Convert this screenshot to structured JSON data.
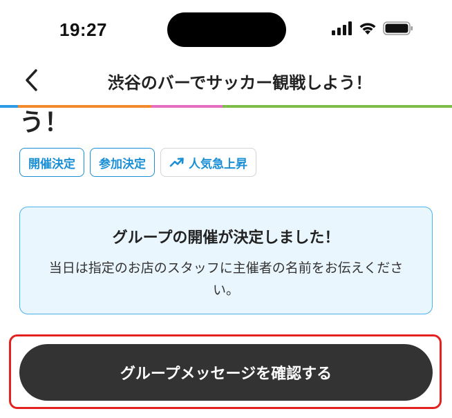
{
  "status_bar": {
    "time": "19:27"
  },
  "nav": {
    "title": "渋谷のバーでサッカー観戦しよう！"
  },
  "progress_colors": [
    "#2e9be6",
    "#f08a2c",
    "#e46fc0",
    "#7fbd4a"
  ],
  "content": {
    "title_tail": "う！",
    "tags": [
      {
        "label": "開催決定"
      },
      {
        "label": "参加決定"
      },
      {
        "label": "人気急上昇",
        "icon": "trending-up-icon"
      }
    ],
    "notice": {
      "title": "グループの開催が決定しました！",
      "body": "当日は指定のお店のスタッフに主催者の名前をお伝えください。"
    },
    "cta": {
      "label": "グループメッセージを確認する"
    }
  },
  "colors": {
    "accent": "#1a8fd6",
    "notice_bg": "#eaf6fd",
    "notice_border": "#49b0ea",
    "button_bg": "#333333",
    "highlight": "#e3221f"
  }
}
